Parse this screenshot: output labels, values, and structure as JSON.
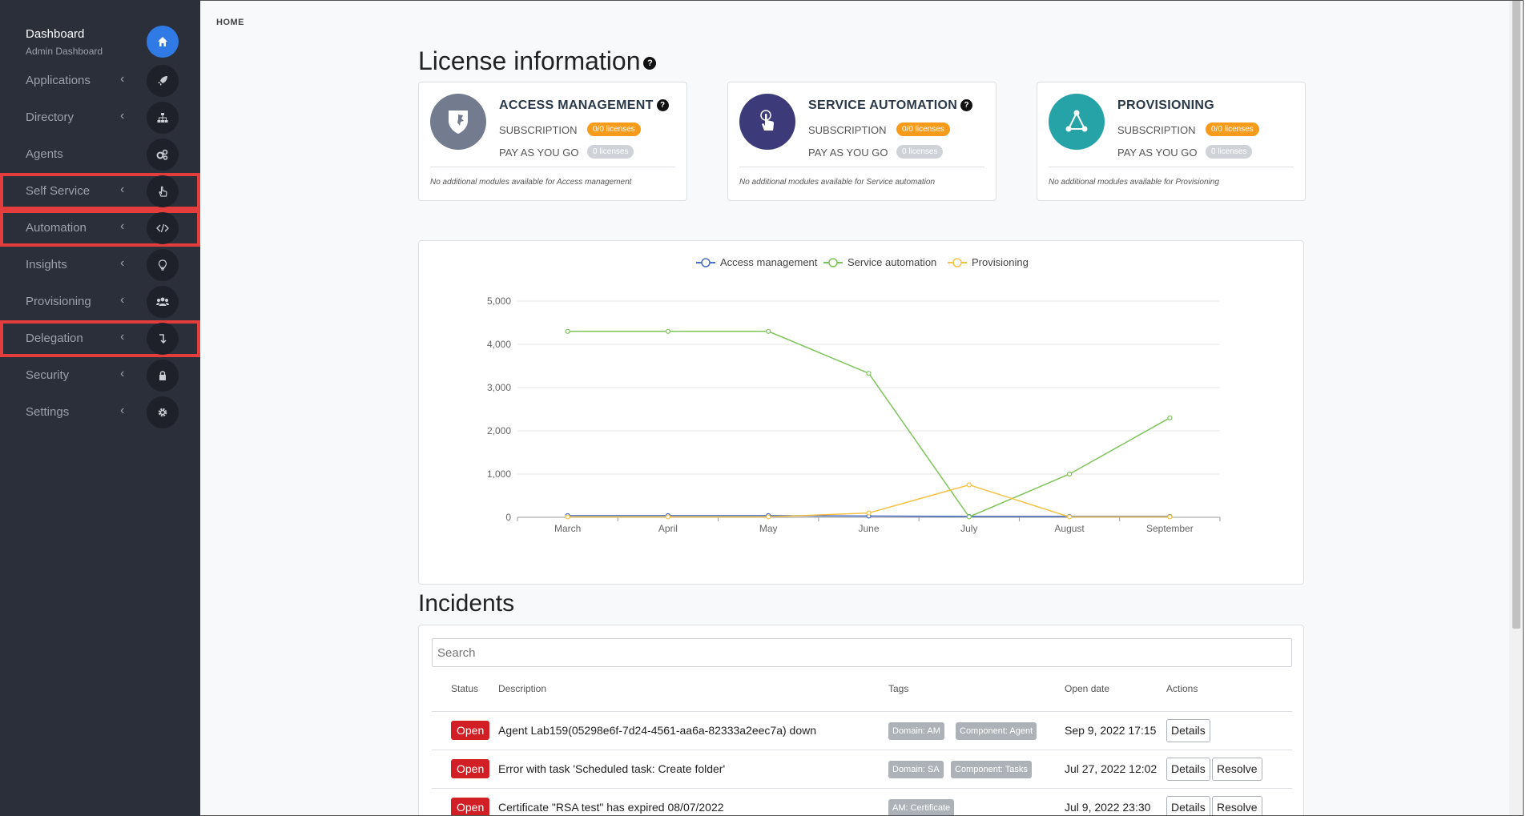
{
  "sidebar": {
    "title": "Dashboard",
    "subtitle": "Admin Dashboard",
    "items": [
      {
        "label": "Applications",
        "icon": "rocket-icon"
      },
      {
        "label": "Directory",
        "icon": "sitemap-icon"
      },
      {
        "label": "Agents",
        "icon": "cogs-icon"
      },
      {
        "label": "Self Service",
        "icon": "pointer-hand-icon"
      },
      {
        "label": "Automation",
        "icon": "code-icon"
      },
      {
        "label": "Insights",
        "icon": "lightbulb-icon"
      },
      {
        "label": "Provisioning",
        "icon": "users-icon"
      },
      {
        "label": "Delegation",
        "icon": "level-down-icon"
      },
      {
        "label": "Security",
        "icon": "lock-icon"
      },
      {
        "label": "Settings",
        "icon": "gear-icon"
      }
    ],
    "chevron": "‹",
    "highlight_color": "#e53c3c"
  },
  "breadcrumb": "HOME",
  "license": {
    "heading": "License information",
    "cards": [
      {
        "title": "ACCESS MANAGEMENT",
        "subscription_label": "SUBSCRIPTION",
        "subscription_badge": "0/0 licenses",
        "payg_label": "PAY AS YOU GO",
        "payg_badge": "0 licenses",
        "note": "No additional modules available for Access management",
        "color": "#737c8e"
      },
      {
        "title": "SERVICE AUTOMATION",
        "subscription_label": "SUBSCRIPTION",
        "subscription_badge": "0/0 licenses",
        "payg_label": "PAY AS YOU GO",
        "payg_badge": "0 licenses",
        "note": "No additional modules available for Service automation",
        "color": "#3c3a78"
      },
      {
        "title": "PROVISIONING",
        "subscription_label": "SUBSCRIPTION",
        "subscription_badge": "0/0 licenses",
        "payg_label": "PAY AS YOU GO",
        "payg_badge": "0 licenses",
        "note": "No additional modules available for Provisioning",
        "color": "#26a3a6"
      }
    ]
  },
  "chart_data": {
    "type": "line",
    "categories": [
      "March",
      "April",
      "May",
      "June",
      "July",
      "August",
      "September"
    ],
    "series": [
      {
        "name": "Access management",
        "color": "#4a6fc4",
        "values": [
          40,
          40,
          40,
          30,
          20,
          20,
          20
        ]
      },
      {
        "name": "Service automation",
        "color": "#7dc45a",
        "values": [
          4300,
          4300,
          4300,
          3330,
          10,
          1000,
          2300
        ]
      },
      {
        "name": "Provisioning",
        "color": "#f5c243",
        "values": [
          10,
          10,
          10,
          100,
          750,
          10,
          10
        ]
      }
    ],
    "yticks": [
      "0",
      "1,000",
      "2,000",
      "3,000",
      "4,000",
      "5,000"
    ],
    "ylim": [
      0,
      5000
    ],
    "grid": true,
    "legend": "top"
  },
  "incidents": {
    "heading": "Incidents",
    "search_placeholder": "Search",
    "columns": [
      "Status",
      "Description",
      "Tags",
      "Open date",
      "Actions"
    ],
    "rows": [
      {
        "status": "Open",
        "description": "Agent Lab159(05298e6f-7d24-4561-aa6a-82333a2eec7a) down",
        "tags": [
          "Domain: AM",
          "Component: Agent"
        ],
        "date": "Sep 9, 2022 17:15",
        "actions": [
          "Details"
        ]
      },
      {
        "status": "Open",
        "description": "Error with task 'Scheduled task: Create folder'",
        "tags": [
          "Domain: SA",
          "Component: Tasks"
        ],
        "date": "Jul 27, 2022 12:02",
        "actions": [
          "Details",
          "Resolve"
        ]
      },
      {
        "status": "Open",
        "description": "Certificate \"RSA test\" has expired 08/07/2022",
        "tags": [
          "AM: Certificate"
        ],
        "date": "Jul 9, 2022 23:30",
        "actions": [
          "Details",
          "Resolve"
        ]
      }
    ]
  }
}
